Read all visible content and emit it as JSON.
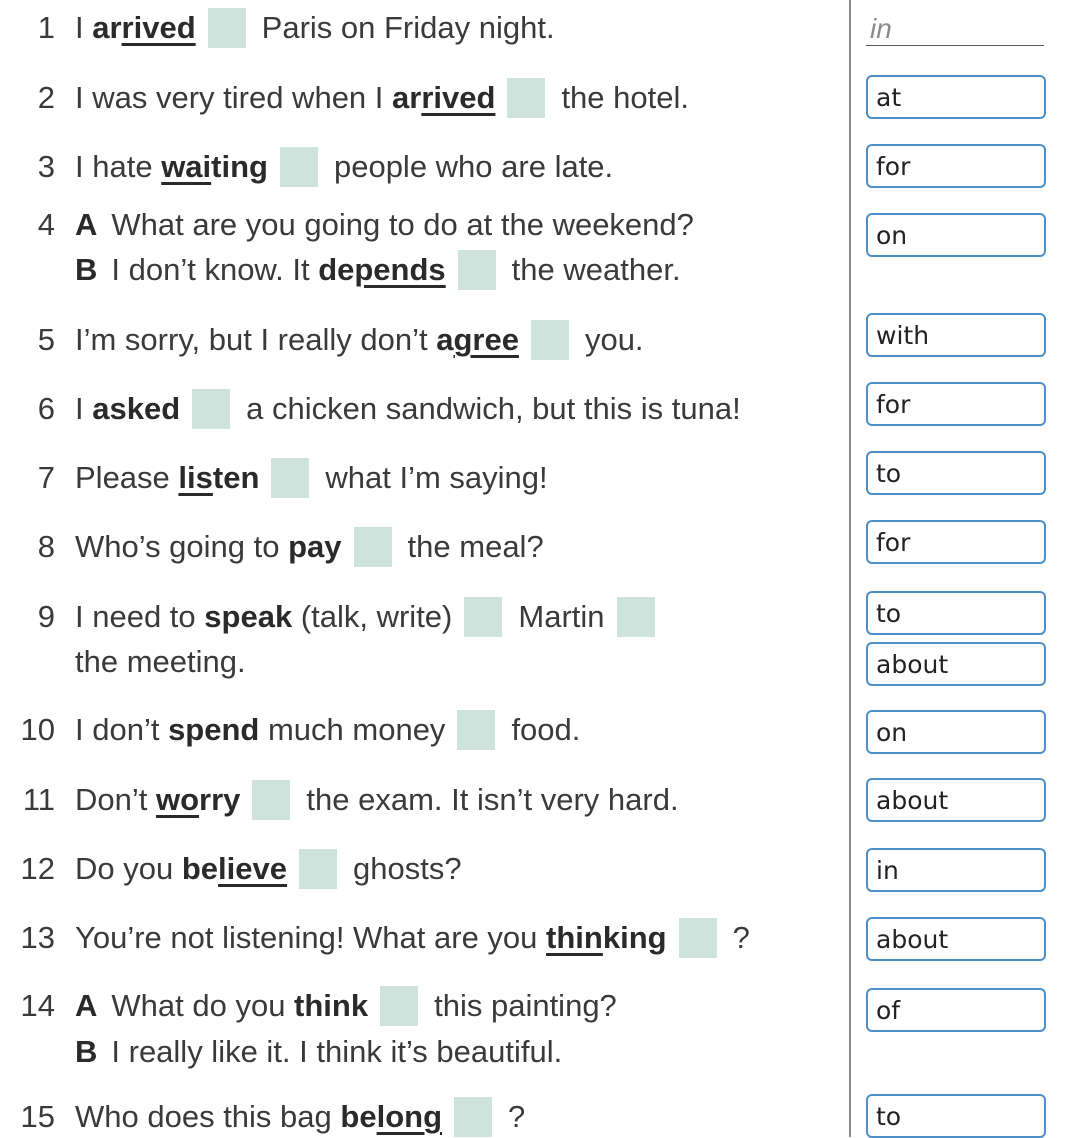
{
  "example_answer": "in",
  "items": [
    {
      "num": "1",
      "lines": [
        [
          {
            "t": "I "
          },
          {
            "t": "ar",
            "b": true
          },
          {
            "t": "rived",
            "b": true,
            "u": true
          },
          {
            "gap": true
          },
          {
            "t": "Paris on Friday night."
          }
        ]
      ],
      "answer": "",
      "gaps": 1
    },
    {
      "num": "2",
      "lines": [
        [
          {
            "t": "I was very tired when I "
          },
          {
            "t": "ar",
            "b": true
          },
          {
            "t": "rived",
            "b": true,
            "u": true
          },
          {
            "gap": true
          },
          {
            "t": "the hotel."
          }
        ]
      ],
      "answers": [
        "at"
      ]
    },
    {
      "num": "3",
      "lines": [
        [
          {
            "t": "I hate "
          },
          {
            "t": "wai",
            "b": true,
            "u": true
          },
          {
            "t": "ting",
            "b": true
          },
          {
            "gap": true
          },
          {
            "t": "people who are late."
          }
        ]
      ],
      "answers": [
        "for"
      ]
    },
    {
      "num": "4",
      "lines": [
        [
          {
            "t": "A",
            "ab": true
          },
          {
            "t": "What are you going to do at the weekend?"
          }
        ],
        [
          {
            "t": "B",
            "ab": true
          },
          {
            "t": "I don’t know. It "
          },
          {
            "t": "de",
            "b": true
          },
          {
            "t": "pends",
            "b": true,
            "u": true
          },
          {
            "gap": true
          },
          {
            "t": "the weather."
          }
        ]
      ],
      "answers": [
        "on"
      ]
    },
    {
      "num": "5",
      "lines": [
        [
          {
            "t": "I’m sorry, but I really don’t "
          },
          {
            "t": "a",
            "b": true
          },
          {
            "t": "gree",
            "b": true,
            "u": true
          },
          {
            "gap": true
          },
          {
            "t": "you."
          }
        ]
      ],
      "answers": [
        "with"
      ]
    },
    {
      "num": "6",
      "lines": [
        [
          {
            "t": "I "
          },
          {
            "t": "asked",
            "b": true
          },
          {
            "gap": true
          },
          {
            "t": "a chicken sandwich, but this is tuna!"
          }
        ]
      ],
      "answers": [
        "for"
      ]
    },
    {
      "num": "7",
      "lines": [
        [
          {
            "t": "Please "
          },
          {
            "t": "lis",
            "b": true,
            "u": true
          },
          {
            "t": "ten",
            "b": true
          },
          {
            "gap": true
          },
          {
            "t": "what I’m saying!"
          }
        ]
      ],
      "answers": [
        "to"
      ]
    },
    {
      "num": "8",
      "lines": [
        [
          {
            "t": "Who’s going to "
          },
          {
            "t": "pay",
            "b": true
          },
          {
            "gap": true
          },
          {
            "t": "the meal?"
          }
        ]
      ],
      "answers": [
        "for"
      ]
    },
    {
      "num": "9",
      "lines": [
        [
          {
            "t": "I need to "
          },
          {
            "t": "speak",
            "b": true
          },
          {
            "t": " (talk, write)"
          },
          {
            "gap": true
          },
          {
            "t": "Martin"
          },
          {
            "gap": true
          }
        ],
        [
          {
            "t": "the meeting."
          }
        ]
      ],
      "answers": [
        "to",
        "about"
      ]
    },
    {
      "num": "10",
      "lines": [
        [
          {
            "t": "I don’t "
          },
          {
            "t": "spend",
            "b": true
          },
          {
            "t": " much money"
          },
          {
            "gap": true
          },
          {
            "t": "food."
          }
        ]
      ],
      "answers": [
        "on"
      ]
    },
    {
      "num": "11",
      "lines": [
        [
          {
            "t": "Don’t "
          },
          {
            "t": "wo",
            "b": true,
            "u": true
          },
          {
            "t": "rry",
            "b": true
          },
          {
            "gap": true
          },
          {
            "t": "the exam. It isn’t very hard."
          }
        ]
      ],
      "answers": [
        "about"
      ]
    },
    {
      "num": "12",
      "lines": [
        [
          {
            "t": "Do you "
          },
          {
            "t": "be",
            "b": true
          },
          {
            "t": "lieve",
            "b": true,
            "u": true
          },
          {
            "gap": true
          },
          {
            "t": "ghosts?"
          }
        ]
      ],
      "answers": [
        "in"
      ]
    },
    {
      "num": "13",
      "lines": [
        [
          {
            "t": "You’re not listening! What are you "
          },
          {
            "t": "thin",
            "b": true,
            "u": true
          },
          {
            "t": "king",
            "b": true
          },
          {
            "gap": true
          },
          {
            "t": "?"
          }
        ]
      ],
      "answers": [
        "about"
      ]
    },
    {
      "num": "14",
      "lines": [
        [
          {
            "t": "A",
            "ab": true
          },
          {
            "t": "What do you "
          },
          {
            "t": "think",
            "b": true
          },
          {
            "gap": true
          },
          {
            "t": "this painting?"
          }
        ],
        [
          {
            "t": "B",
            "ab": true
          },
          {
            "t": "I really like it. I think it’s beautiful."
          }
        ]
      ],
      "answers": [
        "of"
      ]
    },
    {
      "num": "15",
      "lines": [
        [
          {
            "t": "Who does this bag "
          },
          {
            "t": "be",
            "b": true
          },
          {
            "t": "long",
            "b": true,
            "u": true
          },
          {
            "gap": true
          },
          {
            "t": "?"
          }
        ]
      ],
      "answers": [
        "to"
      ]
    }
  ]
}
